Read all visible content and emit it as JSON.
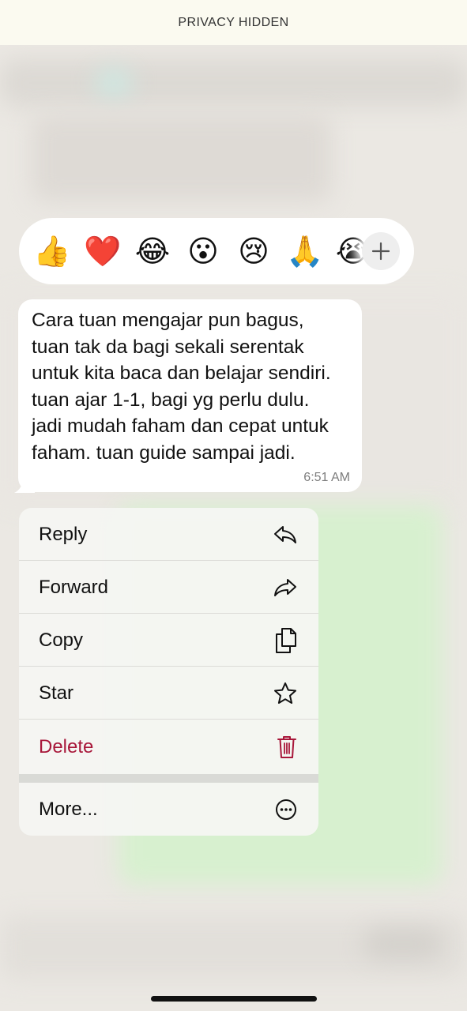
{
  "privacy_banner": {
    "text": "PRIVACY HIDDEN"
  },
  "reactions": {
    "items": [
      {
        "emoji": "👍",
        "name": "thumbs-up"
      },
      {
        "emoji": "❤️",
        "name": "red-heart"
      },
      {
        "emoji": "😂",
        "name": "tears-of-joy"
      },
      {
        "emoji": "😮",
        "name": "surprised"
      },
      {
        "emoji": "😢",
        "name": "crying"
      },
      {
        "emoji": "🙏",
        "name": "folded-hands"
      },
      {
        "emoji": "😭",
        "name": "loudly-crying"
      }
    ],
    "more_icon": "plus-icon"
  },
  "message": {
    "text": "Cara tuan mengajar pun bagus,\ntuan tak da bagi sekali serentak\nuntuk kita baca dan belajar sendiri.\ntuan ajar 1-1, bagi yg perlu dulu.\njadi mudah faham dan cepat untuk\nfaham. tuan guide sampai jadi.",
    "time": "6:51 AM"
  },
  "menu": {
    "reply": {
      "label": "Reply",
      "icon": "reply-icon"
    },
    "forward": {
      "label": "Forward",
      "icon": "forward-icon"
    },
    "copy": {
      "label": "Copy",
      "icon": "copy-icon"
    },
    "star": {
      "label": "Star",
      "icon": "star-icon"
    },
    "delete": {
      "label": "Delete",
      "icon": "trash-icon",
      "color": "#a8173a"
    },
    "more": {
      "label": "More...",
      "icon": "ellipsis-circle-icon"
    }
  }
}
